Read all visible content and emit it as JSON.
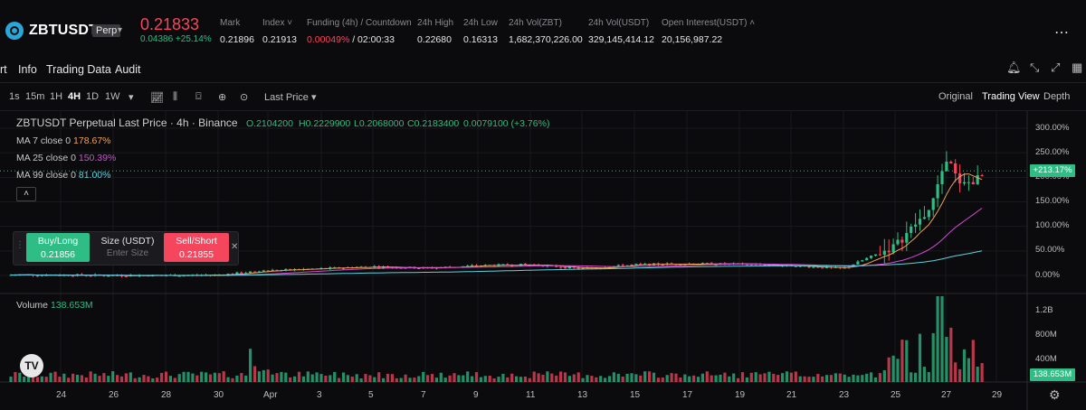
{
  "header": {
    "symbol": "ZBTUSDT",
    "badge": "Perp",
    "last_price": "0.21833",
    "change": "0.04386 +25.14%",
    "stats": [
      {
        "label": "Mark",
        "value": "0.21896",
        "color": "#e8e8e8"
      },
      {
        "label": "Index ˅",
        "value": "0.21913",
        "color": "#e8e8e8"
      },
      {
        "label": "Funding (4h) / Countdown",
        "value": "0.00049%",
        "value2": " / 02:00:33",
        "color": "#f6465d"
      },
      {
        "label": "24h High",
        "value": "0.22680",
        "color": "#e8e8e8"
      },
      {
        "label": "24h Low",
        "value": "0.16313",
        "color": "#e8e8e8"
      },
      {
        "label": "24h Vol(ZBT)",
        "value": "1,682,370,226.00",
        "color": "#e8e8e8"
      },
      {
        "label": "24h Vol(USDT)",
        "value": "329,145,414.12",
        "color": "#e8e8e8"
      },
      {
        "label": "Open Interest(USDT) ˄",
        "value": "20,156,987.22",
        "color": "#e8e8e8"
      }
    ]
  },
  "tabs": [
    "rt",
    "Info",
    "Trading Data",
    "Audit"
  ],
  "toolbar": {
    "intervals": [
      "1s",
      "15m",
      "1H",
      "4H",
      "1D",
      "1W"
    ],
    "active_interval": "4H",
    "price_source": "Last Price",
    "views": [
      "Original",
      "Trading View",
      "Depth"
    ],
    "active_view": "Trading View"
  },
  "legend": {
    "title": "ZBTUSDT Perpetual Last Price · 4h · Binance",
    "o": "O.2104200",
    "h": "H0.2229900",
    "l": "L0.2068000",
    "c": "C0.2183400",
    "chg": "0.0079100 (+3.76%)",
    "ma": [
      {
        "label": "MA 7 close 0",
        "value": "178.67%",
        "color": "#f0a35b"
      },
      {
        "label": "MA 25 close 0",
        "value": "150.39%",
        "color": "#d34bd8"
      },
      {
        "label": "MA 99 close 0",
        "value": "81.00%",
        "color": "#5fd3e0"
      }
    ],
    "volume_label": "Volume",
    "volume_value": "138.653M"
  },
  "order": {
    "buy_label": "Buy/Long",
    "buy_price": "0.21856",
    "size_label": "Size (USDT)",
    "size_placeholder": "Enter Size",
    "sell_label": "Sell/Short",
    "sell_price": "0.21855"
  },
  "axes": {
    "price_ticks": [
      "300.00%",
      "250.00%",
      "200.00%",
      "150.00%",
      "100.00%",
      "50.00%",
      "0.00%"
    ],
    "current_badge": "+213.17%",
    "volume_ticks": [
      "1.2B",
      "800M",
      "400M"
    ],
    "volume_badge": "138.653M",
    "date_ticks": [
      "24",
      "26",
      "28",
      "30",
      "Apr",
      "3",
      "5",
      "7",
      "9",
      "11",
      "13",
      "15",
      "17",
      "19",
      "21",
      "23",
      "25",
      "27",
      "29"
    ]
  },
  "colors": {
    "up": "#2ebd85",
    "down": "#f6465d",
    "ma7": "#f0a35b",
    "ma25": "#d34bd8",
    "ma99": "#5fd3e0"
  },
  "chart_data": {
    "type": "candlestick",
    "y_unit": "% change",
    "ylim": [
      -10,
      320
    ],
    "x": [
      "24",
      "26",
      "28",
      "30",
      "Apr",
      "3",
      "5",
      "7",
      "9",
      "11",
      "13",
      "15",
      "17",
      "19",
      "21",
      "23",
      "25",
      "27",
      "29"
    ],
    "close_pct_approx": [
      1,
      0,
      0,
      1,
      10,
      14,
      18,
      15,
      20,
      22,
      14,
      22,
      24,
      23,
      20,
      14,
      60,
      170,
      213
    ],
    "volume_note": "peak ~1.2B near 27"
  }
}
